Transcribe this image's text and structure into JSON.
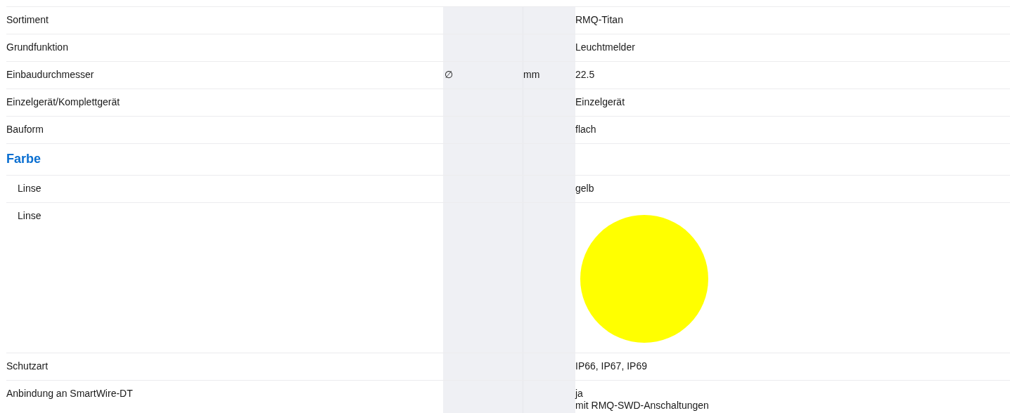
{
  "rows": [
    {
      "kind": "property",
      "label": "Sortiment",
      "value": [
        "RMQ-Titan"
      ]
    },
    {
      "kind": "property",
      "label": "Grundfunktion",
      "value": [
        "Leuchtmelder"
      ]
    },
    {
      "kind": "property",
      "label": "Einbaudurchmesser",
      "symbol": "∅",
      "unit": "mm",
      "value": [
        "22.5"
      ]
    },
    {
      "kind": "property",
      "label": "Einzelgerät/Komplettgerät",
      "value": [
        "Einzelgerät"
      ]
    },
    {
      "kind": "property",
      "label": "Bauform",
      "value": [
        "flach"
      ]
    },
    {
      "kind": "heading",
      "label": "Farbe",
      "children": [
        {
          "kind": "property",
          "label": "Linse",
          "value": [
            "gelb"
          ]
        },
        {
          "kind": "swatch",
          "label": "Linse",
          "color": "#ffff00"
        }
      ]
    },
    {
      "kind": "property",
      "label": "Schutzart",
      "value": [
        "IP66, IP67, IP69"
      ]
    },
    {
      "kind": "property",
      "label": "Anbindung an SmartWire-DT",
      "value": [
        "ja",
        "mit RMQ-SWD-Anschaltungen"
      ]
    }
  ]
}
